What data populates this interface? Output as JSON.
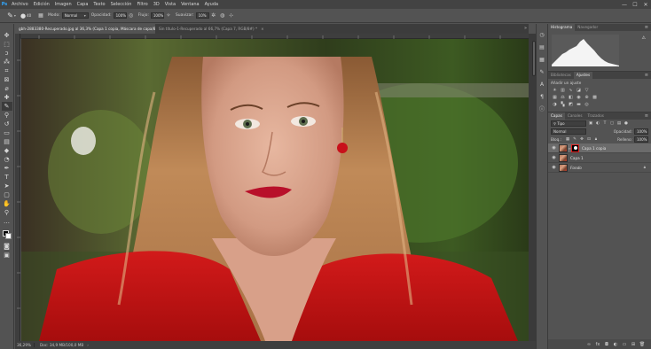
{
  "app": {
    "logo": "Ps"
  },
  "menu": [
    "Archivo",
    "Edición",
    "Imagen",
    "Capa",
    "Texto",
    "Selección",
    "Filtro",
    "3D",
    "Vista",
    "Ventana",
    "Ayuda"
  ],
  "window_controls": {
    "minimize": "—",
    "maximize": "☐",
    "close": "✕"
  },
  "options": {
    "brush_size": "40",
    "mode_label": "Modo:",
    "mode_value": "Normal",
    "opacity_label": "Opacidad:",
    "opacity_value": "100%",
    "flow_label": "Flujo:",
    "flow_value": "100%",
    "smoothing_label": "Suavizar:",
    "smoothing_value": "10%"
  },
  "doc_tabs": [
    {
      "label": "gbh-2883380-Recuperado.jpg al 36,3% (Capa 1 copia, Máscara de capa/8) *",
      "close": "×"
    },
    {
      "label": "Sin título-1-Recuperado al 66,7% (Capa 7, RGB/8#) *",
      "close": "×"
    }
  ],
  "status": {
    "zoom": "36,29%",
    "doc_info": "Doc: 34,9 MB/100,0 MB",
    "arrow": "›"
  },
  "histogram": {
    "tabs": [
      "Histograma",
      "Navegador"
    ],
    "warning_icon": "⚠"
  },
  "adjustments": {
    "tabs": [
      "Bibliotecas",
      "Ajustes"
    ],
    "title": "Añadir un ajuste"
  },
  "layers": {
    "tabs": [
      "Capas",
      "Canales",
      "Trazados"
    ],
    "filter_value": "Tipo",
    "blend_mode": "Normal",
    "opacity_label": "Opacidad:",
    "opacity_value": "100%",
    "lock_label": "Bloq.:",
    "fill_label": "Relleno:",
    "fill_value": "100%",
    "items": [
      {
        "name": "Capa 1 copia",
        "has_mask": true,
        "selected": true,
        "italic": false
      },
      {
        "name": "Capa 1",
        "has_mask": false,
        "selected": false,
        "italic": false
      },
      {
        "name": "Fondo",
        "has_mask": false,
        "selected": false,
        "italic": true
      }
    ]
  }
}
